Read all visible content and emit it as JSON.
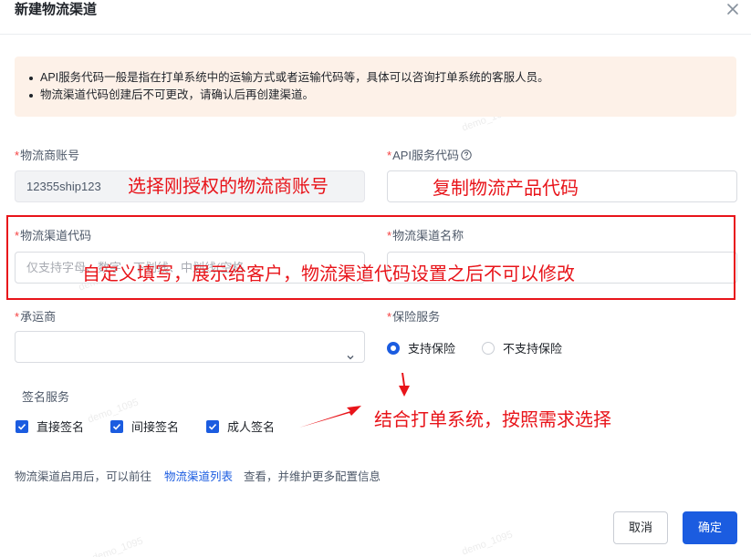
{
  "dialog": {
    "title": "新建物流渠道",
    "close_icon": "close-icon"
  },
  "notice": {
    "lines": [
      "API服务代码一般是指在打单系统中的运输方式或者运输代码等，具体可以咨询打单系统的客服人员。",
      "物流渠道代码创建后不可更改，请确认后再创建渠道。"
    ]
  },
  "form": {
    "carrier_account": {
      "label": "物流商账号",
      "required": "*",
      "value": "12355ship123"
    },
    "api_code": {
      "label": "API服务代码",
      "required": "*",
      "value": ""
    },
    "channel_code": {
      "label": "物流渠道代码",
      "required": "*",
      "placeholder": "仅支持字母、数字、下划线、中划线(空格"
    },
    "channel_name": {
      "label": "物流渠道名称",
      "required": "*",
      "placeholder": ""
    },
    "carrier": {
      "label": "承运商",
      "required": "*",
      "value": ""
    },
    "insurance": {
      "label": "保险服务",
      "required": "*",
      "options": [
        {
          "label": "支持保险",
          "selected": true
        },
        {
          "label": "不支持保险",
          "selected": false
        }
      ]
    },
    "signature": {
      "label": "签名服务",
      "options": [
        {
          "label": "直接签名",
          "checked": true
        },
        {
          "label": "间接签名",
          "checked": true
        },
        {
          "label": "成人签名",
          "checked": true
        }
      ]
    }
  },
  "footer": {
    "text_before": "物流渠道启用后，可以前往",
    "link": "物流渠道列表",
    "text_after": "查看，并维护更多配置信息",
    "cancel": "取消",
    "ok": "确定"
  },
  "annotations": {
    "carrier_hint": "选择刚授权的物流商账号",
    "api_hint": "复制物流产品代码",
    "channel_hint": "自定义填写，展示给客户，物流渠道代码设置之后不可以修改",
    "options_hint": "结合打单系统，按照需求选择",
    "color": "#e8141a"
  },
  "watermark": "demo_1095",
  "colors": {
    "primary": "#1b5ce0",
    "notice_bg": "#fdf1e8",
    "required": "#f53f3f"
  }
}
